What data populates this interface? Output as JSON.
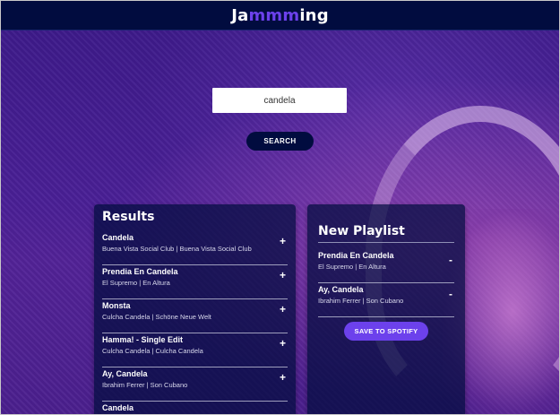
{
  "app": {
    "title_start": "Ja",
    "title_mid": "mmm",
    "title_end": "ing",
    "accent_color": "#6c41ec",
    "bar_color": "#010c3f"
  },
  "search": {
    "value": "candela",
    "button_label": "SEARCH"
  },
  "results": {
    "title": "Results",
    "tracks": [
      {
        "name": "Candela",
        "meta": "Buena Vista Social Club | Buena Vista Social Club",
        "action": "+"
      },
      {
        "name": "Prendia En Candela",
        "meta": "El Supremo | En Altura",
        "action": "+"
      },
      {
        "name": "Monsta",
        "meta": "Culcha Candela | Schöne Neue Welt",
        "action": "+"
      },
      {
        "name": "Hamma! - Single Edit",
        "meta": "Culcha Candela | Culcha Candela",
        "action": "+"
      },
      {
        "name": "Ay, Candela",
        "meta": "Ibrahim Ferrer | Son Cubano",
        "action": "+"
      },
      {
        "name": "Candela",
        "meta": "",
        "action": ""
      }
    ]
  },
  "playlist": {
    "name": "New Playlist",
    "tracks": [
      {
        "name": "Prendia En Candela",
        "meta": "El Supremo | En Altura",
        "action": "-"
      },
      {
        "name": "Ay, Candela",
        "meta": "Ibrahim Ferrer | Son Cubano",
        "action": "-"
      }
    ],
    "save_label": "SAVE TO SPOTIFY"
  }
}
